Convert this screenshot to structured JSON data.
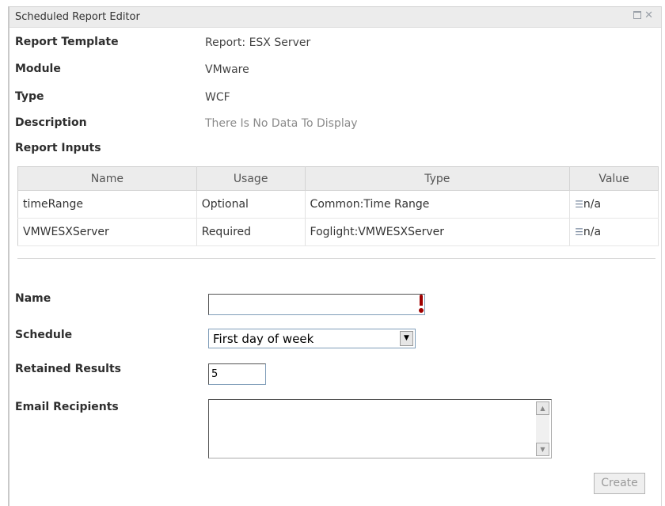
{
  "window": {
    "title": "Scheduled Report Editor"
  },
  "details": {
    "report_template_label": "Report Template",
    "report_template_value": "Report: ESX Server",
    "module_label": "Module",
    "module_value": "VMware",
    "type_label": "Type",
    "type_value": "WCF",
    "description_label": "Description",
    "description_value": "There Is No Data To Display",
    "report_inputs_label": "Report Inputs"
  },
  "inputs_table": {
    "headers": [
      "Name",
      "Usage",
      "Type",
      "Value"
    ],
    "rows": [
      {
        "name": "timeRange",
        "usage": "Optional",
        "type": "Common:Time Range",
        "value": "n/a"
      },
      {
        "name": "VMWESXServer",
        "usage": "Required",
        "type": "Foglight:VMWESXServer",
        "value": "n/a"
      }
    ]
  },
  "form": {
    "name_label": "Name",
    "name_value": "",
    "schedule_label": "Schedule",
    "schedule_value": "First day of week",
    "retained_label": "Retained Results",
    "retained_value": "5",
    "email_label": "Email Recipients",
    "email_value": "",
    "create_label": "Create"
  },
  "icons": {
    "restore": "restore-icon",
    "close": "close-icon",
    "value_editor": "list-edit-icon",
    "required": "required-exclamation-icon",
    "dropdown": "chevron-down-icon"
  },
  "colors": {
    "required": "#a00000",
    "titlebar": "#ececec"
  }
}
